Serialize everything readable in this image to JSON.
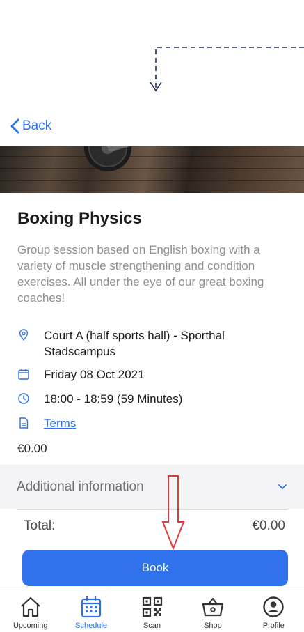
{
  "nav": {
    "back_label": "Back"
  },
  "event": {
    "title": "Boxing Physics",
    "description": "Group session based on English boxing with a variety of muscle strengthening and condition exercises. All under the eye of our great boxing coaches!",
    "location": "Court A (half sports hall) - Sporthal Stadscampus",
    "date": "Friday 08 Oct 2021",
    "time": "18:00 - 18:59 (59 Minutes)",
    "terms_link": "Terms",
    "price": "€0.00"
  },
  "additional_info": {
    "label": "Additional information"
  },
  "total": {
    "label": "Total:",
    "value": "€0.00"
  },
  "book_button": {
    "label": "Book"
  },
  "tabbar": {
    "items": [
      {
        "label": "Upcoming",
        "icon": "home-icon",
        "active": false
      },
      {
        "label": "Schedule",
        "icon": "calendar-icon",
        "active": true
      },
      {
        "label": "Scan",
        "icon": "qr-code-icon",
        "active": false
      },
      {
        "label": "Shop",
        "icon": "basket-icon",
        "active": false
      },
      {
        "label": "Profile",
        "icon": "profile-icon",
        "active": false
      }
    ]
  },
  "colors": {
    "accent": "#2f6fe8",
    "annotation_arrow": "#e23b3b",
    "annotation_dash": "#1c2f5a"
  }
}
